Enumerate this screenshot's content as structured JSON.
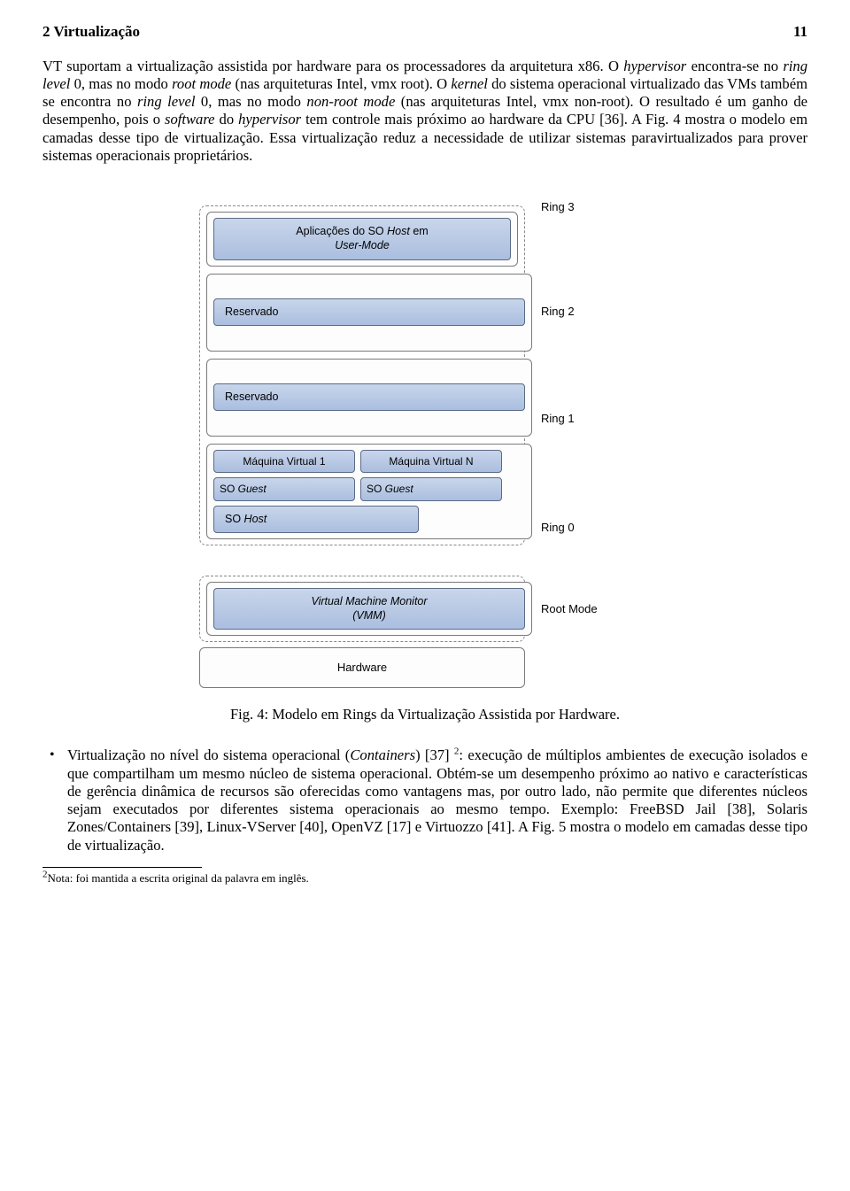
{
  "header": {
    "section": "2 Virtualização",
    "page": "11"
  },
  "para1_parts": {
    "t1": "VT suportam a virtualização assistida por hardware para os processadores da arquitetura x86. O ",
    "i1": "hypervisor",
    "t2": " encontra-se no ",
    "i2": "ring level",
    "t3": " 0, mas no modo ",
    "i3": "root mode",
    "t4": " (nas arquiteturas Intel, vmx root). O ",
    "i4": "kernel",
    "t5": " do sistema operacional virtualizado das VMs também se encontra no ",
    "i5": "ring level",
    "t6": " 0, mas no modo ",
    "i6": "non-root mode",
    "t7": " (nas arquiteturas Intel, vmx non-root). O resultado é um ganho de desempenho, pois o ",
    "i7": "software",
    "t8": " do ",
    "i8": "hypervisor",
    "t9": " tem controle mais próximo ao hardware da CPU [36]. A Fig. 4 mostra o modelo em camadas desse tipo de virtualização. Essa virtualização reduz a necessidade de utilizar sistemas paravirtualizados para prover sistemas operacionais proprietários."
  },
  "diagram": {
    "ring3_label": "Ring 3",
    "ring3_box_l1": "Aplicações do SO ",
    "ring3_box_i": "Host",
    "ring3_box_l2": " em",
    "ring3_box_l3": "User-Mode",
    "ring2_label": "Ring 2",
    "ring2_box": "Reservado",
    "ring1_label": "Ring 1",
    "ring1_box": "Reservado",
    "ring0_label": "Ring 0",
    "vm1": "Máquina Virtual 1",
    "vmN": "Máquina Virtual N",
    "so_guest_pre": "SO ",
    "so_guest_i": "Guest",
    "so_host_pre": "SO ",
    "so_host_i": "Host",
    "root_label": "Root Mode",
    "vmm_l1": "Virtual Machine Monitor",
    "vmm_l2": "(VMM)",
    "hw": "Hardware"
  },
  "caption": "Fig. 4: Modelo em Rings da Virtualização Assistida por Hardware.",
  "bullet_parts": {
    "t1": "Virtualização no nível do sistema operacional (",
    "i1": "Containers",
    "t2": ") [37] ",
    "sup": "2",
    "t3": ": execução de múltiplos ambientes de execução isolados e que compartilham um mesmo núcleo de sistema operacional. Obtém-se um desempenho próximo ao nativo e características de gerência dinâmica de recursos são oferecidas como vantagens mas, por outro lado, não permite que diferentes núcleos sejam executados por diferentes sistema operacionais ao mesmo tempo. Exemplo: FreeBSD Jail [38], Solaris Zones/Containers [39], Linux-VServer [40], OpenVZ [17] e Virtuozzo [41]. A Fig. 5 mostra o modelo em camadas desse tipo de virtualização."
  },
  "footnote": {
    "num": "2",
    "text": "Nota: foi mantida a escrita original da palavra em inglês."
  }
}
